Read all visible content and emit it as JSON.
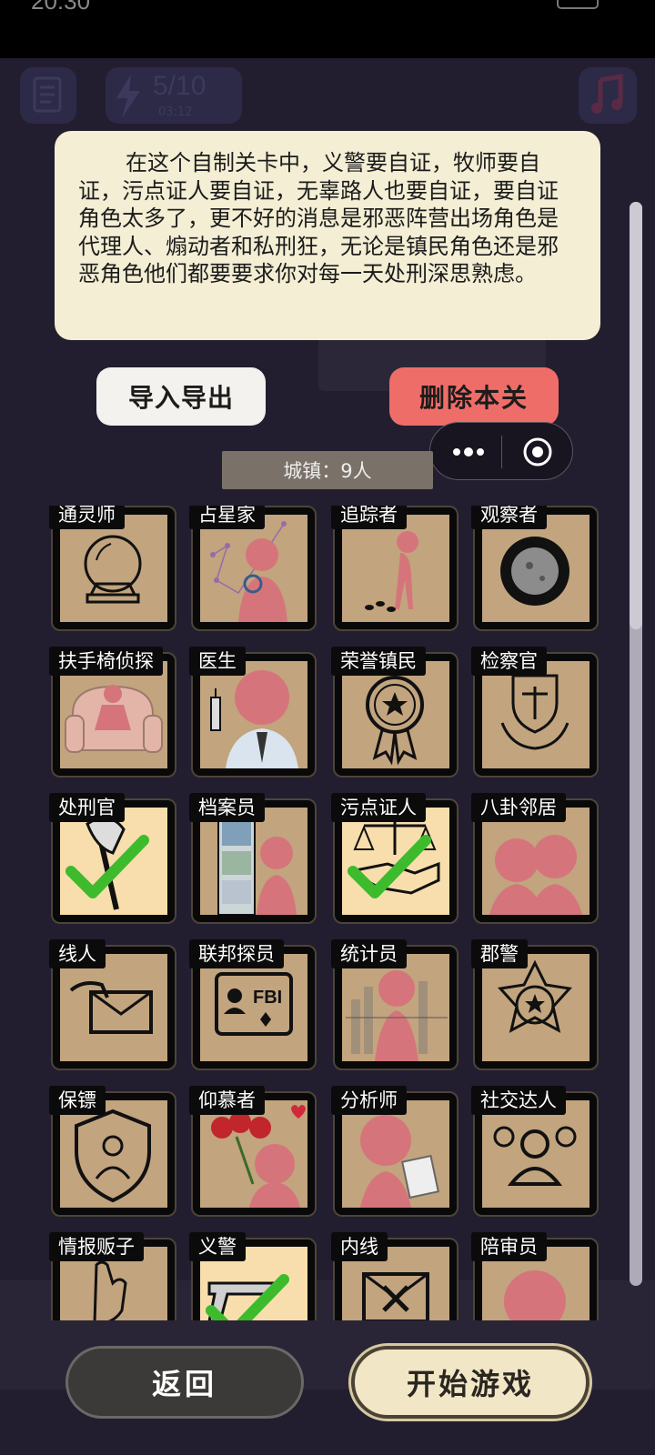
{
  "status_bar": {
    "time": "20:30"
  },
  "background": {
    "energy": "5/10",
    "timer": "03:12"
  },
  "description": "在这个自制关卡中，义警要自证，牧师要自证，污点证人要自证，无辜路人也要自证，要自证角色太多了，更不好的消息是邪恶阵营出场角色是代理人、煽动者和私刑狂，无论是镇民角色还是邪恶角色他们都要要求你对每一天处刑深思熟虑。",
  "buttons": {
    "import_export": "导入导出",
    "delete_level": "删除本关",
    "back": "返回",
    "start_game": "开始游戏"
  },
  "town_count": "城镇：9人",
  "colors": {
    "panel": "#f3eed4",
    "danger": "#ef6d68",
    "card_art": "#c2a47e",
    "card_selected": "#f8deac",
    "check": "#3dbb2c"
  },
  "roles": [
    {
      "name": "通灵师",
      "icon": "crystal-ball-icon",
      "selected": false
    },
    {
      "name": "占星家",
      "icon": "constellation-icon",
      "selected": false
    },
    {
      "name": "追踪者",
      "icon": "footprints-icon",
      "selected": false
    },
    {
      "name": "观察者",
      "icon": "eye-lens-icon",
      "selected": false
    },
    {
      "name": "扶手椅侦探",
      "icon": "armchair-icon",
      "selected": false
    },
    {
      "name": "医生",
      "icon": "syringe-icon",
      "selected": false
    },
    {
      "name": "荣誉镇民",
      "icon": "medal-icon",
      "selected": false
    },
    {
      "name": "检察官",
      "icon": "justice-shield-icon",
      "selected": false
    },
    {
      "name": "处刑官",
      "icon": "axe-icon",
      "selected": true
    },
    {
      "name": "档案员",
      "icon": "bookshelf-icon",
      "selected": false
    },
    {
      "name": "污点证人",
      "icon": "scales-handshake-icon",
      "selected": true
    },
    {
      "name": "八卦邻居",
      "icon": "whisper-icon",
      "selected": false
    },
    {
      "name": "线人",
      "icon": "envelope-icon",
      "selected": false
    },
    {
      "name": "联邦探员",
      "icon": "fbi-badge-icon",
      "selected": false,
      "badge_text": "FBI"
    },
    {
      "name": "统计员",
      "icon": "bar-chart-icon",
      "selected": false
    },
    {
      "name": "郡警",
      "icon": "sheriff-star-icon",
      "selected": false
    },
    {
      "name": "保镖",
      "icon": "bodyguard-shield-icon",
      "selected": false
    },
    {
      "name": "仰慕者",
      "icon": "roses-icon",
      "selected": false
    },
    {
      "name": "分析师",
      "icon": "analyst-paper-icon",
      "selected": false
    },
    {
      "name": "社交达人",
      "icon": "group-icon",
      "selected": false
    },
    {
      "name": "情报贩子",
      "icon": "hand-icon",
      "selected": false
    },
    {
      "name": "义警",
      "icon": "pistol-icon",
      "selected": true
    },
    {
      "name": "内线",
      "icon": "envelope-x-icon",
      "selected": false
    },
    {
      "name": "陪审员",
      "icon": "person-icon",
      "selected": false
    }
  ]
}
